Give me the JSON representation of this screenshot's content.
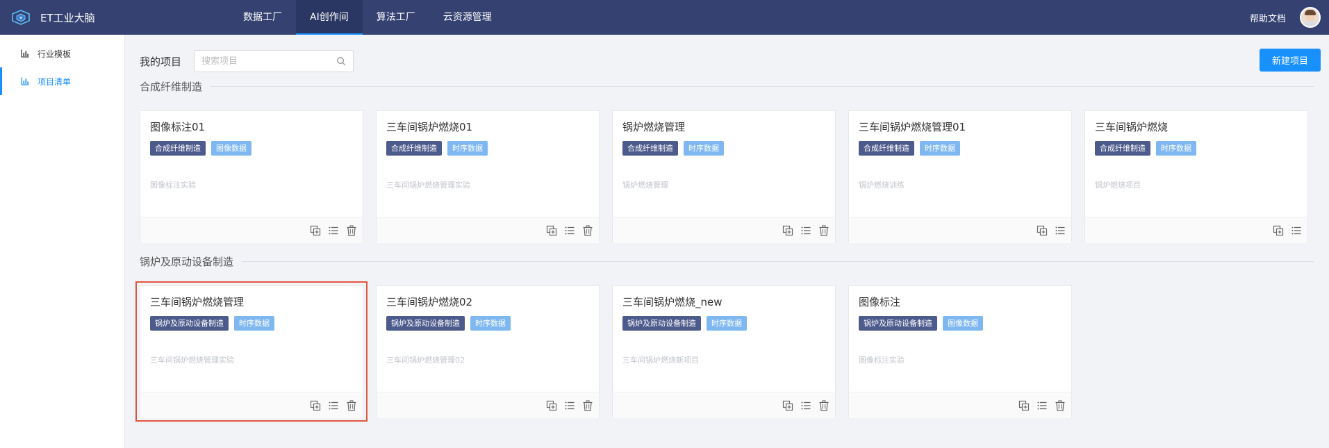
{
  "brand": {
    "title": "ET工业大脑"
  },
  "nav": [
    {
      "label": "数据工厂",
      "active": false
    },
    {
      "label": "AI创作间",
      "active": true
    },
    {
      "label": "算法工厂",
      "active": false
    },
    {
      "label": "云资源管理",
      "active": false
    }
  ],
  "top_right": {
    "help": "帮助文档"
  },
  "sidebar": [
    {
      "label": "行业模板",
      "active": false
    },
    {
      "label": "项目清单",
      "active": true
    }
  ],
  "header": {
    "title": "我的项目",
    "search_placeholder": "搜索项目",
    "new_button": "新建项目"
  },
  "sections": [
    {
      "title": "合成纤维制造",
      "cards": [
        {
          "title": "图像标注01",
          "tags": [
            "合成纤维制造",
            "图像数据"
          ],
          "desc": "图像标注实验",
          "delete": true
        },
        {
          "title": "三车间锅炉燃烧01",
          "tags": [
            "合成纤维制造",
            "时序数据"
          ],
          "desc": "三车间锅炉燃烧管理实验",
          "delete": true
        },
        {
          "title": "锅炉燃烧管理",
          "tags": [
            "合成纤维制造",
            "时序数据"
          ],
          "desc": "锅炉燃烧管理",
          "delete": true
        },
        {
          "title": "三车间锅炉燃烧管理01",
          "tags": [
            "合成纤维制造",
            "时序数据"
          ],
          "desc": "锅炉燃烧训练",
          "delete": false
        },
        {
          "title": "三车间锅炉燃烧",
          "tags": [
            "合成纤维制造",
            "时序数据"
          ],
          "desc": "锅炉燃烧项目",
          "delete": false
        }
      ]
    },
    {
      "title": "锅炉及原动设备制造",
      "cards": [
        {
          "title": "三车间锅炉燃烧管理",
          "tags": [
            "锅炉及原动设备制造",
            "时序数据"
          ],
          "desc": "三车间锅炉燃烧管理实验",
          "delete": true
        },
        {
          "title": "三车间锅炉燃烧02",
          "tags": [
            "锅炉及原动设备制造",
            "时序数据"
          ],
          "desc": "三车间锅炉燃烧管理02",
          "delete": true
        },
        {
          "title": "三车间锅炉燃烧_new",
          "tags": [
            "锅炉及原动设备制造",
            "时序数据"
          ],
          "desc": "三车间锅炉燃烧新项目",
          "delete": true
        },
        {
          "title": "图像标注",
          "tags": [
            "锅炉及原动设备制造",
            "图像数据"
          ],
          "desc": "图像标注实验",
          "delete": true
        }
      ]
    }
  ],
  "colors": {
    "nav_bg": "#344171",
    "accent": "#1890ff",
    "tag_dark": "#4d5a8c",
    "tag_light": "#7fb8f0",
    "highlight": "#e2563f"
  }
}
